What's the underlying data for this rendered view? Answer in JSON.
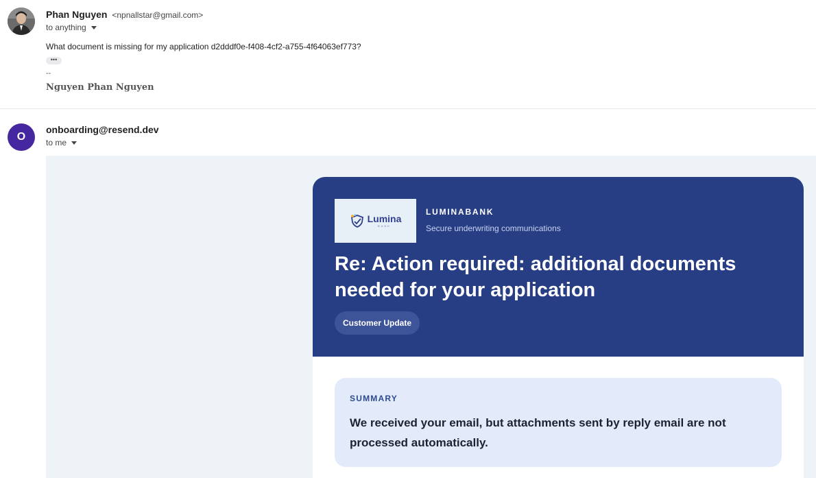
{
  "message1": {
    "sender_name": "Phan Nguyen",
    "sender_email": "<npnallstar@gmail.com>",
    "to_label": "to anything",
    "body": "What document is missing for my application d2dddf0e-f408-4cf2-a755-4f64063ef773?",
    "trimmed_indicator": "•••",
    "signature_dash": "--",
    "signature_name": "Nguyen Phan Nguyen"
  },
  "message2": {
    "avatar_letter": "O",
    "sender": "onboarding@resend.dev",
    "to_label": "to me"
  },
  "email": {
    "logo_word": "Lumina",
    "logo_sub": "BANK",
    "brand_name": "LUMINABANK",
    "brand_tagline": "Secure underwriting communications",
    "title": "Re: Action required: additional documents needed for your application",
    "badge": "Customer Update",
    "summary_label": "SUMMARY",
    "summary_text": "We received your email, but attachments sent by reply email are not processed automatically."
  },
  "colors": {
    "header_bg": "#273e85",
    "avatar_o_bg": "#4527a0",
    "summary_bg": "#e3ebfb",
    "email_bg": "#eef3f8"
  }
}
